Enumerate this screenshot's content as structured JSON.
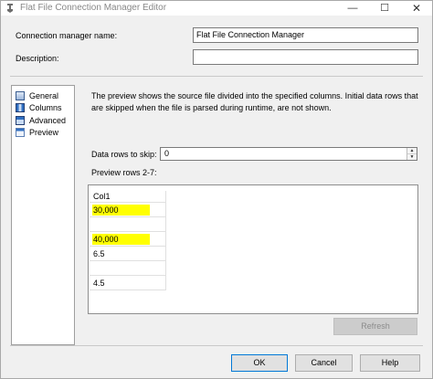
{
  "window": {
    "title": "Flat File Connection Manager Editor",
    "controls": {
      "minimize": "—",
      "maximize": "☐",
      "close": "✕"
    }
  },
  "form": {
    "name_label": "Connection manager name:",
    "name_value": "Flat File Connection Manager",
    "description_label": "Description:",
    "description_value": ""
  },
  "nav": {
    "items": [
      {
        "label": "General",
        "icon": "general-icon"
      },
      {
        "label": "Columns",
        "icon": "columns-icon"
      },
      {
        "label": "Advanced",
        "icon": "advanced-icon"
      },
      {
        "label": "Preview",
        "icon": "preview-icon"
      }
    ]
  },
  "preview": {
    "description": "The preview shows the source file divided into the specified columns. Initial data rows that are skipped when the file is parsed during runtime, are not shown.",
    "skip_label": "Data rows to skip:",
    "skip_value": "0",
    "rows_label": "Preview rows 2-7:",
    "grid": {
      "header": "Col1",
      "rows": [
        {
          "value": "30,000",
          "highlighted": true
        },
        {
          "value": "",
          "highlighted": false
        },
        {
          "value": "40,000",
          "highlighted": true
        },
        {
          "value": "6.5",
          "highlighted": false
        },
        {
          "value": "",
          "highlighted": false
        },
        {
          "value": "4.5",
          "highlighted": false
        }
      ]
    },
    "refresh_label": "Refresh"
  },
  "buttons": {
    "ok": "OK",
    "cancel": "Cancel",
    "help": "Help"
  },
  "colors": {
    "highlight": "#ffff00",
    "ok_border": "#0078d7"
  }
}
